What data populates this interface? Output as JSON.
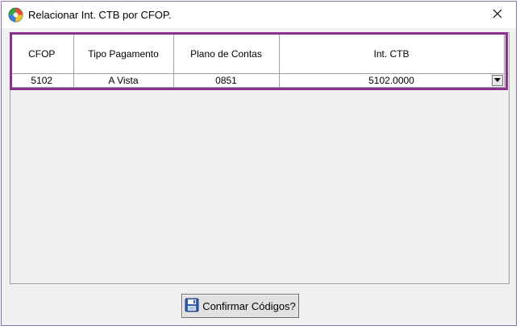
{
  "window": {
    "title": "Relacionar Int. CTB por CFOP.",
    "close_icon": "close-icon",
    "app_icon": "app-globe-icon"
  },
  "grid": {
    "columns": [
      "CFOP",
      "Tipo Pagamento",
      "Plano de Contas",
      "Int. CTB"
    ],
    "rows": [
      {
        "cfop": "5102",
        "tipo_pagamento": "A Vista",
        "plano_de_contas": "0851",
        "int_ctb": "5102.0000"
      }
    ],
    "highlight_color": "#8b2f8f"
  },
  "footer": {
    "confirm_label": "Confirmar Códigos?",
    "confirm_icon": "save-floppy-icon"
  }
}
